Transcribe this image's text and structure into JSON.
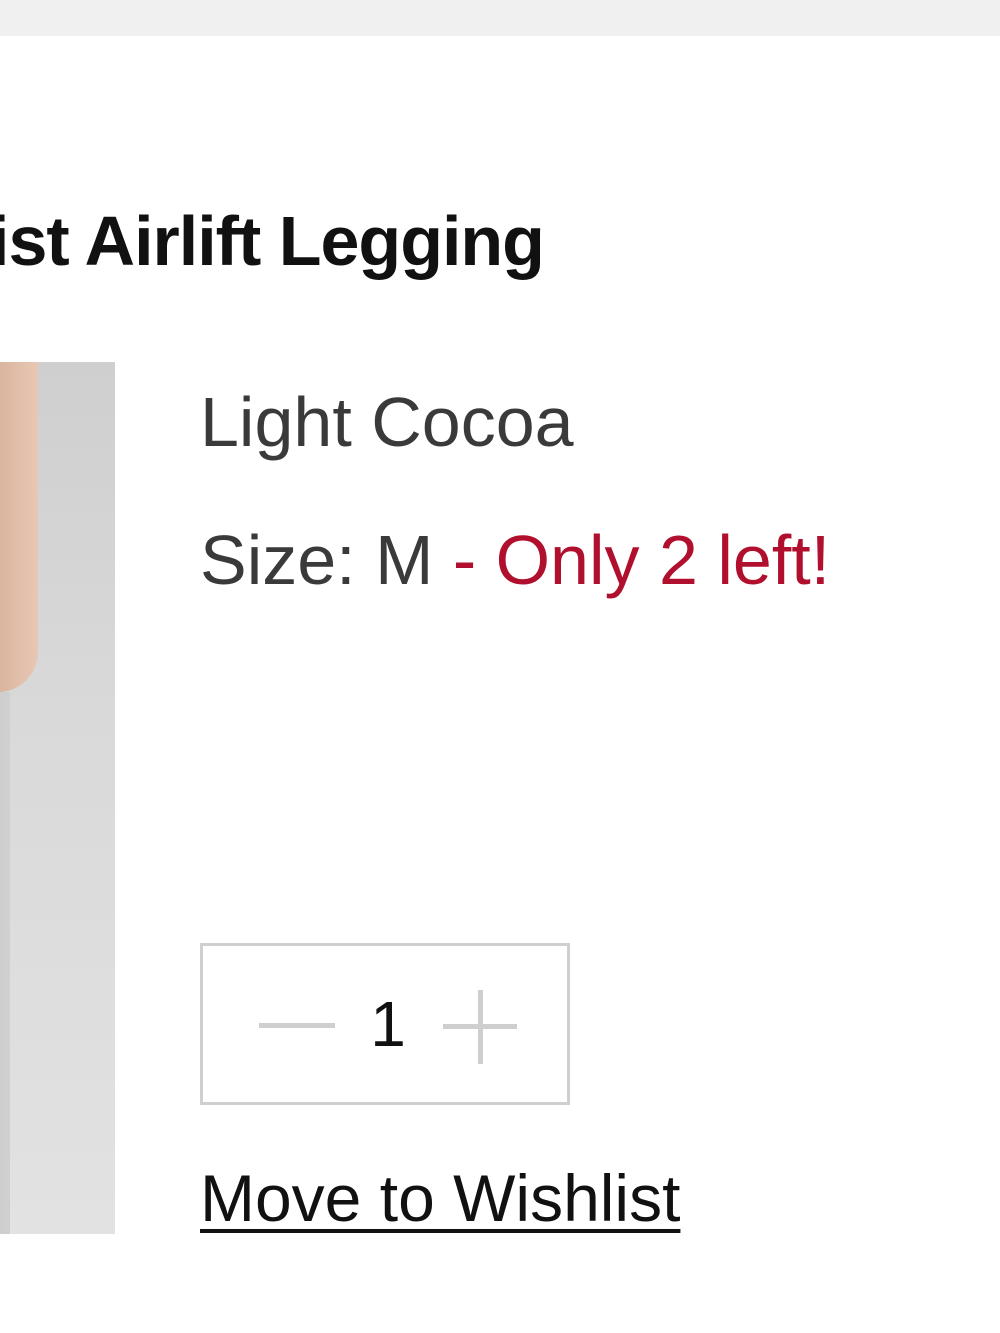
{
  "product": {
    "title": "ist Airlift Legging",
    "color": "Light Cocoa",
    "size_label": "Size: M",
    "stock_warning": " - Only 2 left!"
  },
  "quantity": {
    "value": "1",
    "decrement_icon": "minus-icon",
    "increment_icon": "plus-icon"
  },
  "actions": {
    "wishlist_label": "Move to Wishlist"
  },
  "colors": {
    "stock_warning": "#b0102e",
    "stepper_border": "#cfcfcf",
    "top_bar": "#f0f0f0"
  }
}
